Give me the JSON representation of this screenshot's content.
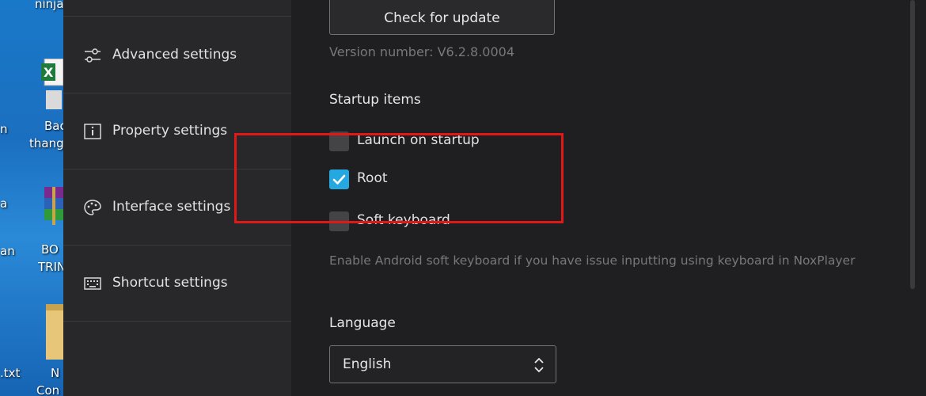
{
  "desktop": {
    "labels": [
      "ninja",
      "Bac",
      "thang",
      "BO",
      "TRIN",
      "an",
      "n",
      "a",
      ".txt",
      "N",
      "Con"
    ]
  },
  "sidebar": {
    "items": [
      {
        "label": "Advanced settings",
        "icon": "sliders-icon"
      },
      {
        "label": "Property settings",
        "icon": "info-icon"
      },
      {
        "label": "Interface settings",
        "icon": "palette-icon"
      },
      {
        "label": "Shortcut settings",
        "icon": "keyboard-icon"
      }
    ]
  },
  "main": {
    "update_button": "Check for update",
    "version": "Version number: V6.2.8.0004",
    "startup_title": "Startup items",
    "startup_items": [
      {
        "label": "Launch on startup",
        "checked": false
      },
      {
        "label": "Root",
        "checked": true
      },
      {
        "label": "Soft keyboard",
        "checked": false
      }
    ],
    "soft_keyboard_help": "Enable Android soft keyboard if you have issue inputting using keyboard in NoxPlayer",
    "language_title": "Language",
    "language_value": "English"
  },
  "colors": {
    "accent": "#25a7e0",
    "highlight": "#e01818",
    "panel_bg": "#1f1f21",
    "sidebar_bg": "#28282a"
  }
}
